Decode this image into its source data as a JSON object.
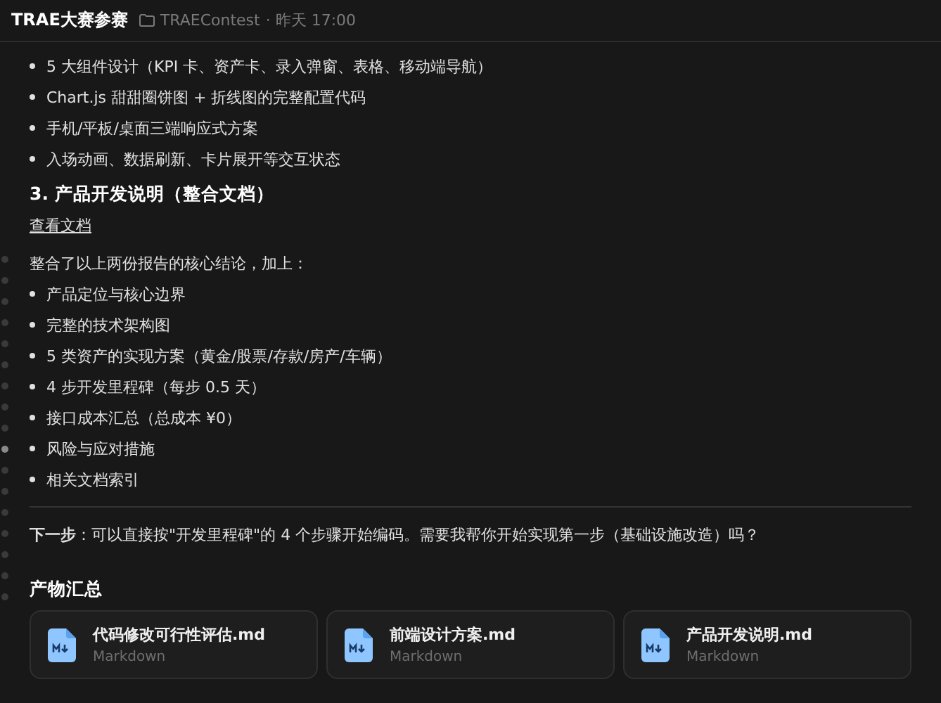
{
  "header": {
    "title": "TRAE大赛参赛",
    "project": "TRAEContest",
    "time": "· 昨天 17:00"
  },
  "list_top": [
    "5 大组件设计（KPI 卡、资产卡、录入弹窗、表格、移动端导航）",
    "Chart.js 甜甜圈饼图 + 折线图的完整配置代码",
    "手机/平板/桌面三端响应式方案",
    "入场动画、数据刷新、卡片展开等交互状态"
  ],
  "section": {
    "heading": "3. 产品开发说明（整合文档）",
    "link": "查看文档",
    "intro": "整合了以上两份报告的核心结论，加上：",
    "items": [
      "产品定位与核心边界",
      "完整的技术架构图",
      "5 类资产的实现方案（黄金/股票/存款/房产/车辆）",
      "4 步开发里程碑（每步 0.5 天）",
      "接口成本汇总（总成本 ¥0）",
      "风险与应对措施",
      "相关文档索引"
    ]
  },
  "next_step": "**下一步**：可以直接按\"开发里程碑\"的 4 个步骤开始编码。需要我帮你开始实现第一步（基础设施改造）吗？",
  "artifacts": {
    "heading": "产物汇总",
    "files": [
      {
        "name": "代码修改可行性评估.md",
        "type": "Markdown"
      },
      {
        "name": "前端设计方案.md",
        "type": "Markdown"
      },
      {
        "name": "产品开发说明.md",
        "type": "Markdown"
      }
    ]
  },
  "outline_markers": [
    {
      "selected": false
    },
    {
      "selected": false
    },
    {
      "selected": false
    },
    {
      "selected": false
    },
    {
      "selected": false
    },
    {
      "selected": false
    },
    {
      "selected": false
    },
    {
      "selected": false
    },
    {
      "selected": false
    },
    {
      "selected": true
    },
    {
      "selected": false
    },
    {
      "selected": false
    },
    {
      "selected": false
    },
    {
      "selected": false
    },
    {
      "selected": false
    },
    {
      "selected": false
    },
    {
      "selected": false
    }
  ]
}
